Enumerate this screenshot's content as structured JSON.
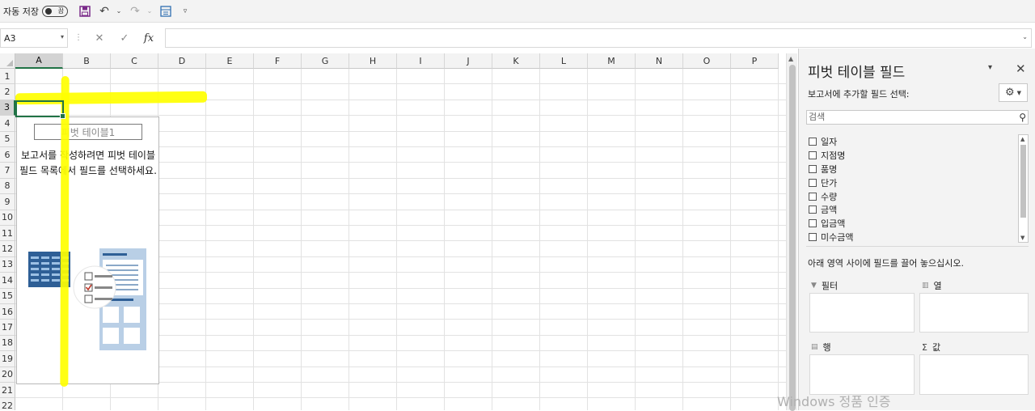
{
  "toolbar": {
    "autosave_label": "자동 저장",
    "autosave_state": "끔",
    "icons": [
      "save-icon",
      "undo-icon",
      "redo-icon",
      "form-icon",
      "customize-icon"
    ]
  },
  "formula_bar": {
    "name_box": "A3",
    "fx": "fx",
    "formula": ""
  },
  "grid": {
    "columns": [
      "A",
      "B",
      "C",
      "D",
      "E",
      "F",
      "G",
      "H",
      "I",
      "J",
      "K",
      "L",
      "M",
      "N",
      "O",
      "P"
    ],
    "rows": [
      "1",
      "2",
      "3",
      "4",
      "5",
      "6",
      "7",
      "8",
      "9",
      "10",
      "11",
      "12",
      "13",
      "14",
      "15",
      "16",
      "17",
      "18",
      "19",
      "20",
      "21",
      "22"
    ],
    "selected_cell": "A3"
  },
  "pivot_placeholder": {
    "name": "피벗 테이블1",
    "message": "보고서를 작성하려면 피벗 테이블 필드 목록에서 필드를 선택하세요."
  },
  "pane": {
    "title": "피벗 테이블 필드",
    "subtitle": "보고서에 추가할 필드 선택:",
    "search_placeholder": "검색",
    "fields": [
      "일자",
      "지점명",
      "품명",
      "단가",
      "수량",
      "금액",
      "입금액",
      "미수금액"
    ],
    "hint": "아래 영역 사이에 필드를 끌어 놓으십시오.",
    "areas": {
      "filter": "필터",
      "columns": "열",
      "rows": "행",
      "values": "값"
    }
  },
  "watermark": "Windows 정품 인증",
  "colors": {
    "selection": "#217346",
    "highlight": "#ffff00"
  }
}
